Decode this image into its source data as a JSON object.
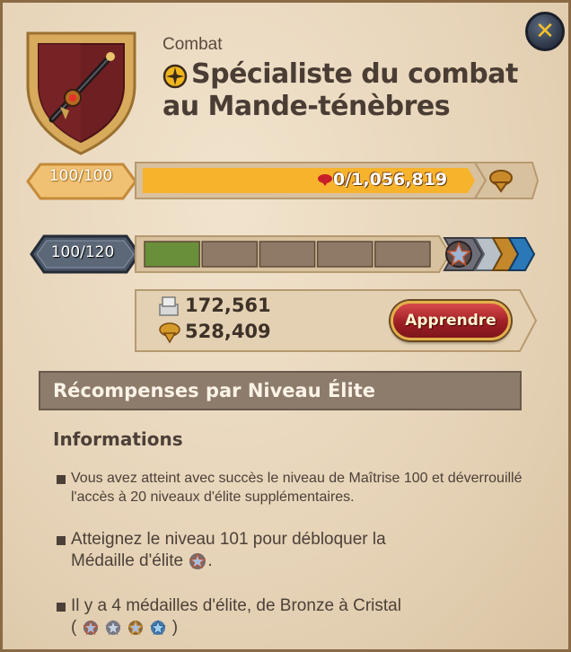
{
  "header": {
    "category": "Combat",
    "title_line1": "Spécialiste du combat",
    "title_line2": "au Mande-ténèbres"
  },
  "progress": {
    "level_text": "100/100",
    "xp_text": "0/1,056,819",
    "fill_fraction": 1.0
  },
  "elite": {
    "level_text": "100/120",
    "segments": [
      {
        "filled": true
      },
      {
        "filled": false
      },
      {
        "filled": false
      },
      {
        "filled": false
      },
      {
        "filled": false
      }
    ]
  },
  "costs": {
    "silver": "172,561",
    "fame": "528,409",
    "learn_label": "Apprendre"
  },
  "rewards": {
    "heading": "Récompenses par Niveau Élite"
  },
  "info": {
    "heading": "Informations",
    "p1": "Vous avez atteint avec succès le niveau de Maîtrise 100 et déverrouillé l'accès à 20 niveaux d'élite supplémentaires.",
    "p2_line1": "Atteignez le niveau 101 pour débloquer la",
    "p2_line2a": "Médaille d'élite",
    "p2_line2b": ".",
    "p3_line1": "Il y a 4 médailles d'élite, de Bronze à Cristal",
    "p3_open": "(",
    "p3_close": ")"
  },
  "colors": {
    "xp_fill": "#f7b32c",
    "elite_fill": "#6a8f3a",
    "learn_button": "#9e1f25"
  },
  "icons": [
    "weapon-shield-icon",
    "specialization-icon",
    "close-icon",
    "fame-icon",
    "silver-icon",
    "elite-medal-icon"
  ]
}
